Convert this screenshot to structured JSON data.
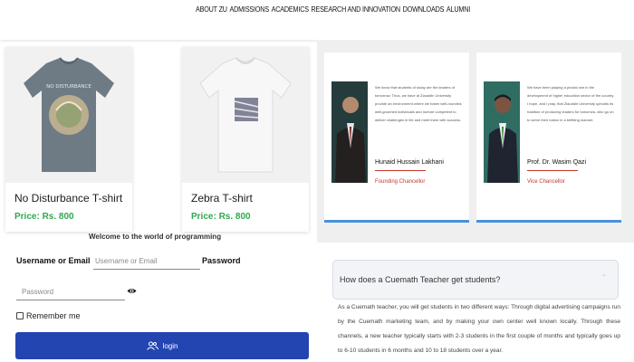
{
  "nav": {
    "links": [
      "ABOUT ZU",
      "ADMISSIONS",
      "ACADEMICS",
      "RESEARCH AND INNOVATION",
      "DOWNLOADS",
      "ALUMNI"
    ]
  },
  "products": [
    {
      "name": "No Disturbance T-shirt",
      "price": "Price: Rs. 800",
      "shirt_color": "#6e7b85",
      "image_text": "NO DISTURBANCE"
    },
    {
      "name": "Zebra T-shirt",
      "price": "Price: Rs. 800",
      "shirt_color": "#f5f5f5"
    }
  ],
  "profiles": [
    {
      "name": "Hunaid Hussain Lakhani",
      "role": "Founding Chancellor",
      "quote": "We know that students of today are the leaders of tomorrow. Thus, we have at Ziauddin University provide an environment where we foster well-rounded, well-groomed individuals and nurture competent to deliver challenges in life and meet them with success."
    },
    {
      "name": "Prof. Dr. Wasim Qazi",
      "role": "Vice Chancellor",
      "quote": "We have been playing a pivotal role in the development of higher education sector of the country. I hope, and I pray, that Ziauddin University upholds its tradition of producing leaders for tomorrow, who go on to serve their nation in a befitting manner."
    }
  ],
  "login": {
    "welcome": "Welcome to the world of programming",
    "username_label": "Username or Email",
    "username_placeholder": "Username or Email",
    "password_label": "Password",
    "password_placeholder": "Password",
    "remember_label": "Remember me",
    "button_label": "login"
  },
  "faq": {
    "question": "How does a Cuemath Teacher get students?",
    "answer": "As a Cuemath teacher, you will get students in two different ways: Through digital advertising campaigns run by the Cuemath marketing team, and by making your own center well known locally. Through these channels, a new teacher typically starts with 2-3 students in the first couple of months and typically goes up to 6-10 students in 6 months and 10 to 18 students over a year."
  },
  "colors": {
    "accent": "#2345b2",
    "price": "#2fa84f",
    "card_border": "#4a90d9",
    "role": "#c0392b"
  }
}
